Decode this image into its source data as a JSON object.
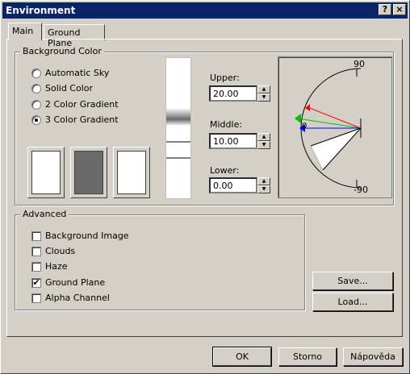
{
  "window": {
    "title": "Environment",
    "help_glyph": "?",
    "close_glyph": "×"
  },
  "tabs": [
    {
      "label": "Main",
      "active": true
    },
    {
      "label": "Ground Plane",
      "active": false
    }
  ],
  "background_color": {
    "group_label": "Background Color",
    "options": [
      {
        "label": "Automatic Sky",
        "selected": false
      },
      {
        "label": "Solid Color",
        "selected": false
      },
      {
        "label": "2 Color Gradient",
        "selected": false
      },
      {
        "label": "3 Color Gradient",
        "selected": true
      }
    ],
    "swatches": [
      {
        "name": "upper",
        "color": "#ffffff"
      },
      {
        "name": "middle",
        "color": "#6a6a6a"
      },
      {
        "name": "lower",
        "color": "#ffffff"
      }
    ],
    "upper": {
      "label": "Upper:",
      "value": "20.00"
    },
    "middle": {
      "label": "Middle:",
      "value": "10.00"
    },
    "lower": {
      "label": "Lower:",
      "value": "0.00"
    },
    "angle_dial": {
      "top_label": "90",
      "bottom_label": "-90",
      "zero_label": "0",
      "colors": {
        "red": "#ff0000",
        "green": "#00c000",
        "blue": "#0000ff"
      }
    }
  },
  "advanced": {
    "group_label": "Advanced",
    "options": [
      {
        "label": "Background Image",
        "checked": false
      },
      {
        "label": "Clouds",
        "checked": false
      },
      {
        "label": "Haze",
        "checked": false
      },
      {
        "label": "Ground Plane",
        "checked": true
      },
      {
        "label": "Alpha Channel",
        "checked": false
      }
    ]
  },
  "buttons": {
    "save": "Save...",
    "load": "Load...",
    "ok": "OK",
    "cancel": "Storno",
    "help": "Nápověda"
  },
  "icons": {
    "checkmark": "✔",
    "spin_up": "▲",
    "spin_down": "▼"
  }
}
